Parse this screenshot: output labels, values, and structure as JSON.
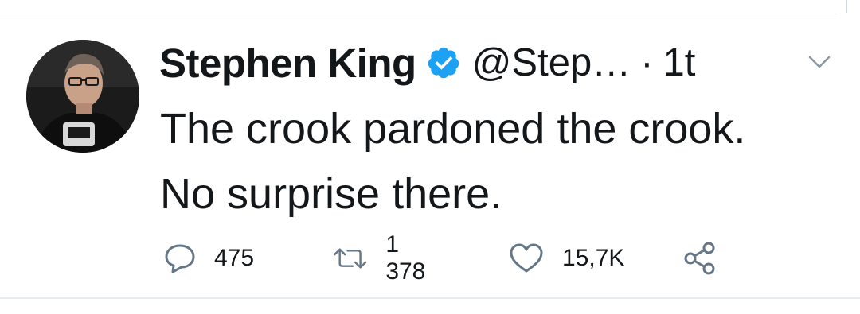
{
  "tweet": {
    "author_name": "Stephen King",
    "verified": true,
    "handle": "@Step…",
    "separator": "·",
    "time": "1t",
    "text": "The crook pardoned the crook. No surprise there."
  },
  "actions": {
    "replies": "475",
    "retweets": "1 378",
    "likes": "15,7K"
  },
  "icons": {
    "verified": "verified-badge-icon",
    "menu": "chevron-down-icon",
    "reply": "reply-icon",
    "retweet": "retweet-icon",
    "like": "heart-icon",
    "share": "share-icon"
  },
  "colors": {
    "verified_blue": "#1da1f2",
    "text": "#14171a",
    "icon_gray": "#657786",
    "divider": "#e1e8ed"
  }
}
